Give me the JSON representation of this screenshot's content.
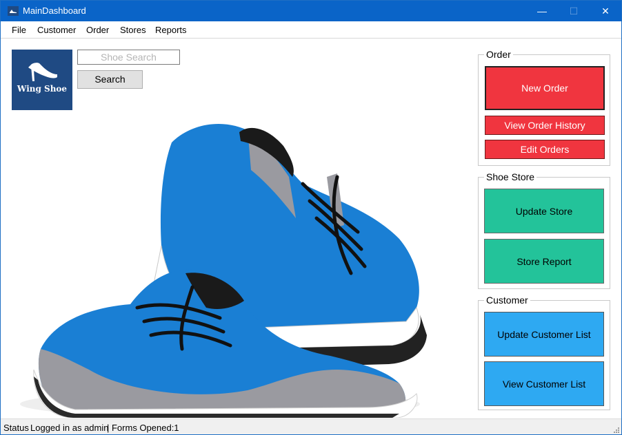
{
  "window": {
    "title": "MainDashboard",
    "controls": {
      "minimize": "—",
      "maximize": "☐",
      "close": "✕"
    }
  },
  "menu": [
    "File",
    "Customer",
    "Order",
    "Stores",
    "Reports"
  ],
  "logo": {
    "text": "Wing Shoe"
  },
  "search": {
    "placeholder": "Shoe Search",
    "value": "",
    "button_label": "Search"
  },
  "groups": {
    "order": {
      "title": "Order",
      "buttons": [
        "New Order",
        "View Order History",
        "Edit Orders"
      ]
    },
    "store": {
      "title": "Shoe Store",
      "buttons": [
        "Update Store",
        "Store Report"
      ]
    },
    "customer": {
      "title": "Customer",
      "buttons": [
        "Update Customer List",
        "View Customer List"
      ]
    }
  },
  "status": {
    "label": "Status",
    "user": "Logged in as admin",
    "forms": "| Forms Opened:1"
  },
  "colors": {
    "titlebar": "#0a64c8",
    "order_red": "#f0353f",
    "store_green": "#23c39a",
    "customer_blue": "#2ea9f2",
    "logo_blue": "#1f4a83"
  }
}
